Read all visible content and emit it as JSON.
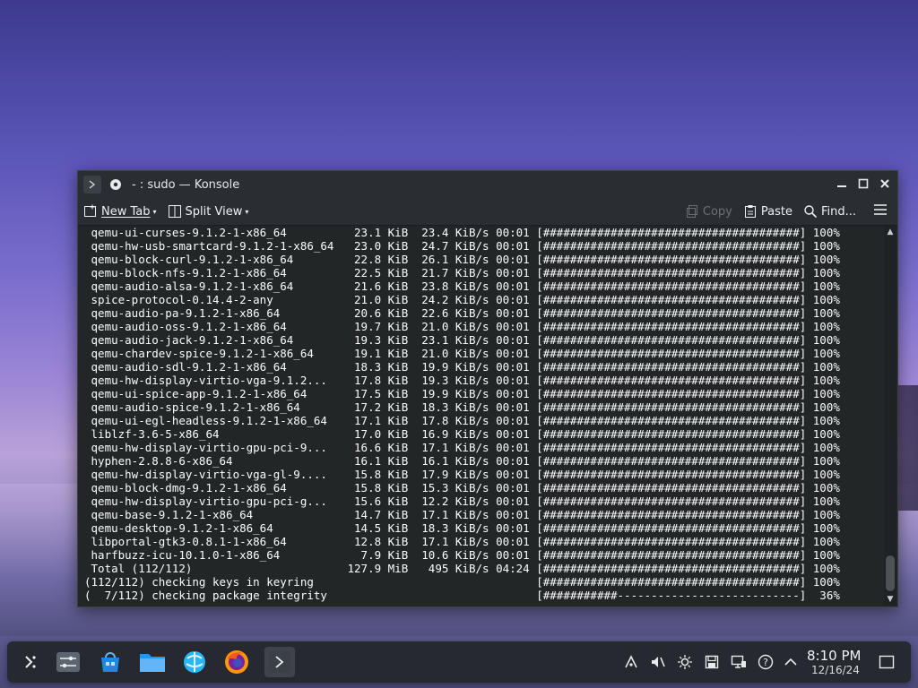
{
  "window": {
    "title": "- : sudo — Konsole"
  },
  "toolbar": {
    "new_tab": "New Tab",
    "split_view": "Split View",
    "copy": "Copy",
    "paste": "Paste",
    "find": "Find..."
  },
  "terminal": {
    "lines": [
      " qemu-ui-curses-9.1.2-1-x86_64          23.1 KiB  23.4 KiB/s 00:01 [######################################] 100%",
      " qemu-hw-usb-smartcard-9.1.2-1-x86_64   23.0 KiB  24.7 KiB/s 00:01 [######################################] 100%",
      " qemu-block-curl-9.1.2-1-x86_64         22.8 KiB  26.1 KiB/s 00:01 [######################################] 100%",
      " qemu-block-nfs-9.1.2-1-x86_64          22.5 KiB  21.7 KiB/s 00:01 [######################################] 100%",
      " qemu-audio-alsa-9.1.2-1-x86_64         21.6 KiB  23.8 KiB/s 00:01 [######################################] 100%",
      " spice-protocol-0.14.4-2-any            21.0 KiB  24.2 KiB/s 00:01 [######################################] 100%",
      " qemu-audio-pa-9.1.2-1-x86_64           20.6 KiB  22.6 KiB/s 00:01 [######################################] 100%",
      " qemu-audio-oss-9.1.2-1-x86_64          19.7 KiB  21.0 KiB/s 00:01 [######################################] 100%",
      " qemu-audio-jack-9.1.2-1-x86_64         19.3 KiB  23.1 KiB/s 00:01 [######################################] 100%",
      " qemu-chardev-spice-9.1.2-1-x86_64      19.1 KiB  21.0 KiB/s 00:01 [######################################] 100%",
      " qemu-audio-sdl-9.1.2-1-x86_64          18.3 KiB  19.9 KiB/s 00:01 [######################################] 100%",
      " qemu-hw-display-virtio-vga-9.1.2...    17.8 KiB  19.3 KiB/s 00:01 [######################################] 100%",
      " qemu-ui-spice-app-9.1.2-1-x86_64       17.5 KiB  19.9 KiB/s 00:01 [######################################] 100%",
      " qemu-audio-spice-9.1.2-1-x86_64        17.2 KiB  18.3 KiB/s 00:01 [######################################] 100%",
      " qemu-ui-egl-headless-9.1.2-1-x86_64    17.1 KiB  17.8 KiB/s 00:01 [######################################] 100%",
      " liblzf-3.6-5-x86_64                    17.0 KiB  16.9 KiB/s 00:01 [######################################] 100%",
      " qemu-hw-display-virtio-gpu-pci-9...    16.6 KiB  17.1 KiB/s 00:01 [######################################] 100%",
      " hyphen-2.8.8-6-x86_64                  16.1 KiB  16.1 KiB/s 00:01 [######################################] 100%",
      " qemu-hw-display-virtio-vga-gl-9....    15.8 KiB  17.9 KiB/s 00:01 [######################################] 100%",
      " qemu-block-dmg-9.1.2-1-x86_64          15.8 KiB  15.3 KiB/s 00:01 [######################################] 100%",
      " qemu-hw-display-virtio-gpu-pci-g...    15.6 KiB  12.2 KiB/s 00:01 [######################################] 100%",
      " qemu-base-9.1.2-1-x86_64               14.7 KiB  17.1 KiB/s 00:01 [######################################] 100%",
      " qemu-desktop-9.1.2-1-x86_64            14.5 KiB  18.3 KiB/s 00:01 [######################################] 100%",
      " libportal-gtk3-0.8.1-1-x86_64          12.8 KiB  17.1 KiB/s 00:01 [######################################] 100%",
      " harfbuzz-icu-10.1.0-1-x86_64            7.9 KiB  10.6 KiB/s 00:01 [######################################] 100%",
      " Total (112/112)                       127.9 MiB   495 KiB/s 04:24 [######################################] 100%",
      "(112/112) checking keys in keyring                                 [######################################] 100%",
      "(  7/112) checking package integrity                               [###########---------------------------]  36%"
    ]
  },
  "taskbar": {
    "apps": [
      "launcher-icon",
      "system-settings-icon",
      "discover-store-icon",
      "file-manager-icon",
      "browser-icon",
      "firefox-icon",
      "konsole-icon"
    ],
    "tray": [
      "network-icon",
      "volume-muted-icon",
      "brightness-icon",
      "save-icon",
      "display-icon",
      "help-icon",
      "expand-tray-icon"
    ],
    "time": "8:10 PM",
    "date": "12/16/24"
  }
}
